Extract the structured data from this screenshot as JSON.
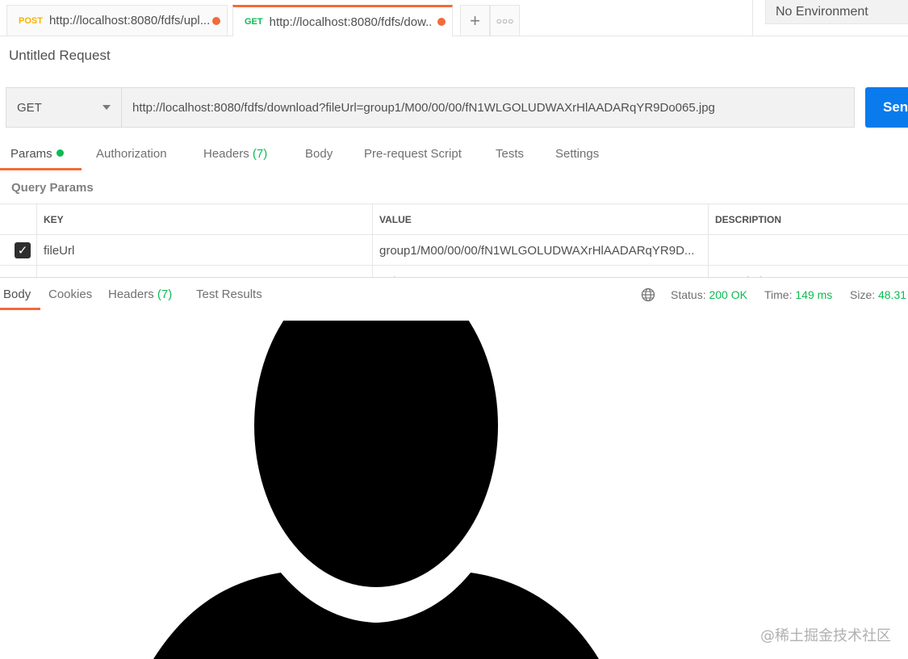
{
  "tabs": [
    {
      "method": "POST",
      "title": "http://localhost:8080/fdfs/upl..."
    },
    {
      "method": "GET",
      "title": "http://localhost:8080/fdfs/dow..."
    }
  ],
  "environment": {
    "selected": "No Environment"
  },
  "request": {
    "title": "Untitled Request",
    "method": "GET",
    "url": "http://localhost:8080/fdfs/download?fileUrl=group1/M00/00/00/fN1WLGOLUDWAXrHlAADARqYR9Do065.jpg",
    "send_label": "Send"
  },
  "request_tabs": {
    "params": "Params",
    "authorization": "Authorization",
    "headers": "Headers",
    "headers_count": "(7)",
    "body": "Body",
    "prerequest": "Pre-request Script",
    "tests": "Tests",
    "settings": "Settings"
  },
  "query_params": {
    "label": "Query Params",
    "columns": {
      "key": "KEY",
      "value": "VALUE",
      "description": "DESCRIPTION"
    },
    "rows": [
      {
        "checked": true,
        "key": "fileUrl",
        "value": "group1/M00/00/00/fN1WLGOLUDWAXrHlAADARqYR9D...",
        "description": ""
      }
    ],
    "placeholder": {
      "key": "Key",
      "value": "Value",
      "description": "Description"
    }
  },
  "response_tabs": {
    "body": "Body",
    "cookies": "Cookies",
    "headers": "Headers",
    "headers_count": "(7)",
    "test_results": "Test Results"
  },
  "response_meta": {
    "status_label": "Status:",
    "status_value": "200 OK",
    "time_label": "Time:",
    "time_value": "149 ms",
    "size_label": "Size:",
    "size_value": "48.31"
  },
  "watermark": "@稀土掘金技术社区",
  "colors": {
    "accent": "#f26b3a",
    "send": "#097bed",
    "success": "#0cbb52",
    "post": "#f4b400"
  }
}
